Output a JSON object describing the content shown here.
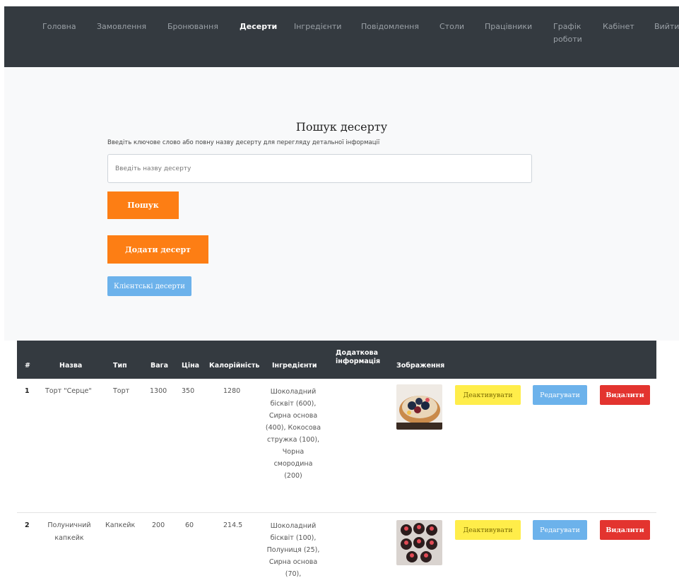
{
  "nav": {
    "items": [
      {
        "label": "Головна"
      },
      {
        "label": "Замовлення"
      },
      {
        "label": "Бронювання"
      },
      {
        "label": "Десерти"
      },
      {
        "label": "Інгредієнти"
      },
      {
        "label": "Повідомлення"
      },
      {
        "label": "Столи"
      },
      {
        "label": "Працівники"
      },
      {
        "label": "Графік роботи"
      },
      {
        "label": "Кабінет"
      },
      {
        "label": "Вийти"
      }
    ],
    "active": "Десерти"
  },
  "search": {
    "title": "Пошук десерту",
    "hint": "Введіть ключове слово або повну назву десерту для перегляду детальної інформації",
    "placeholder": "Введіть назву десерту",
    "button_label": "Пошук"
  },
  "actions": {
    "add_label": "Додати десерт",
    "clients_label": "Клієнтські десерти"
  },
  "table": {
    "headers": {
      "num": "#",
      "name": "Назва",
      "type": "Тип",
      "weight": "Вага",
      "price": "Ціна",
      "calories": "Калорійність",
      "ingredients": "Інгредієнти",
      "extra": "Додаткова інформація",
      "image": "Зображення"
    },
    "row_actions": {
      "deactivate": "Деактивувати",
      "edit": "Редагувати",
      "delete": "Видалити"
    },
    "rows": [
      {
        "num": "1",
        "name": "Торт \"Серце\"",
        "type": "Торт",
        "weight": "1300",
        "price": "350",
        "calories": "1280",
        "ingredients": "Шоколадний бісквіт (600), Сирна основа (400), Кокосова стружка (100), Чорна смородина (200)",
        "extra": ""
      },
      {
        "num": "2",
        "name": "Полуничний капкейк",
        "type": "Капкейк",
        "weight": "200",
        "price": "60",
        "calories": "214.5",
        "ingredients": "Шоколадний бісквіт (100), Полуниця (25), Сирна основа (70),",
        "extra": ""
      }
    ]
  },
  "colors": {
    "navbar": "#343a40",
    "orange": "#fd7e14",
    "blue": "#6cb2eb",
    "yellow": "#ffed4a",
    "red": "#e3342f"
  }
}
